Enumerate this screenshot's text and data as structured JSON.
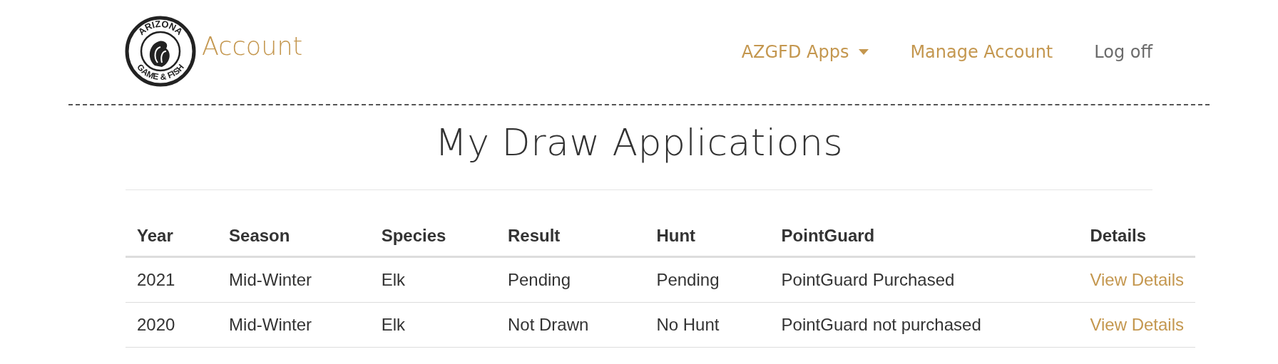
{
  "header": {
    "logo": {
      "top_text": "ARIZONA",
      "bottom_text": "GAME & FISH"
    },
    "title": "Account",
    "nav": [
      {
        "label": "AZGFD Apps",
        "kind": "dropdown"
      },
      {
        "label": "Manage Account",
        "kind": "link"
      },
      {
        "label": "Log off",
        "kind": "plain"
      }
    ]
  },
  "page_title": "My Draw Applications",
  "table": {
    "columns": [
      "Year",
      "Season",
      "Species",
      "Result",
      "Hunt",
      "PointGuard",
      "Details"
    ],
    "rows": [
      {
        "cells": [
          "2021",
          "Mid-Winter",
          "Elk",
          "Pending",
          "Pending",
          "PointGuard Purchased"
        ],
        "link": "View Details"
      },
      {
        "cells": [
          "2020",
          "Mid-Winter",
          "Elk",
          "Not Drawn",
          "No Hunt",
          "PointGuard not purchased"
        ],
        "link": "View Details"
      }
    ]
  }
}
